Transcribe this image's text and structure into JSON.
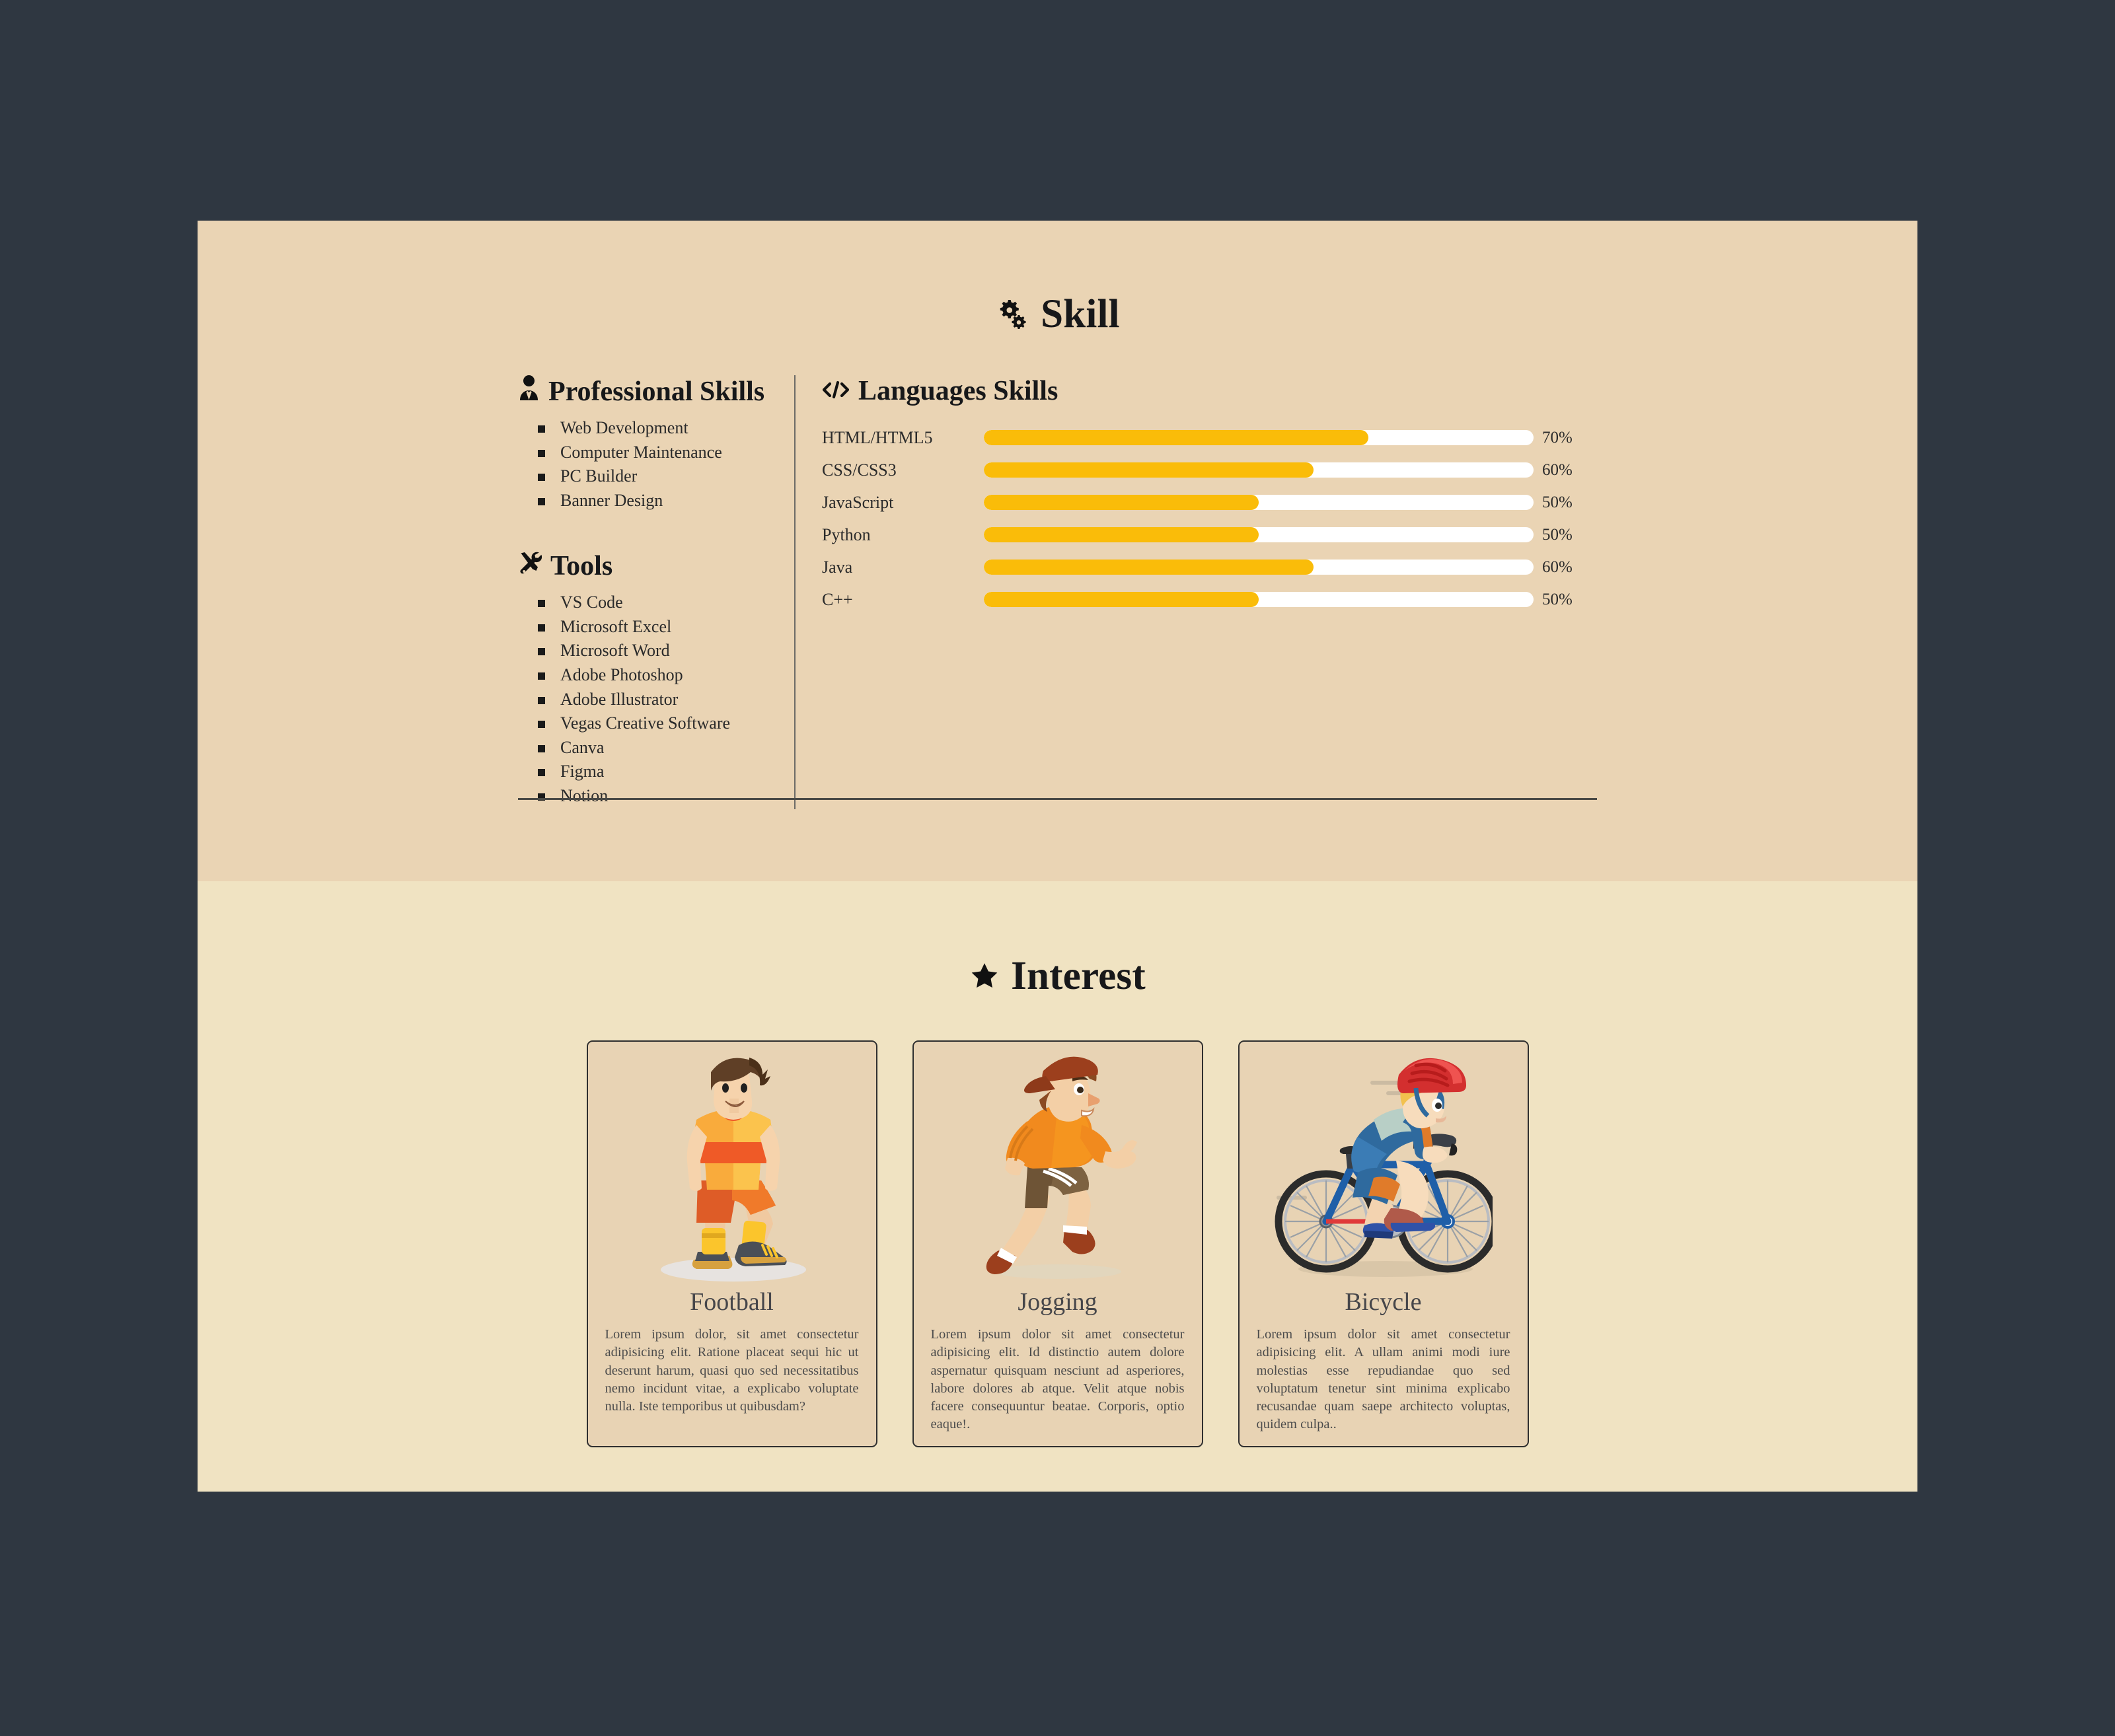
{
  "skill": {
    "title": "Skill",
    "title_icon": "gears-icon",
    "professional": {
      "heading": "Professional Skills",
      "icon": "person-tie-icon",
      "items": [
        "Web Development",
        "Computer Maintenance",
        "PC Builder",
        "Banner Design"
      ]
    },
    "tools": {
      "heading": "Tools",
      "icon": "wrench-screwdriver-icon",
      "items": [
        "VS Code",
        "Microsoft Excel",
        "Microsoft Word",
        "Adobe Photoshop",
        "Adobe Illustrator",
        "Vegas Creative Software",
        "Canva",
        "Figma",
        "Notion"
      ]
    },
    "languages": {
      "heading": "Languages Skills",
      "icon": "code-tag-icon",
      "bar_fill_color": "#FABC09",
      "bar_track_color": "#FFFFFF",
      "items": [
        {
          "name": "HTML/HTML5",
          "percent": 70,
          "label": "70%"
        },
        {
          "name": "CSS/CSS3",
          "percent": 60,
          "label": "60%"
        },
        {
          "name": "JavaScript",
          "percent": 50,
          "label": "50%"
        },
        {
          "name": "Python",
          "percent": 50,
          "label": "50%"
        },
        {
          "name": "Java",
          "percent": 60,
          "label": "60%"
        },
        {
          "name": "C++",
          "percent": 50,
          "label": "50%"
        }
      ]
    }
  },
  "interest": {
    "title": "Interest",
    "title_icon": "star-icon",
    "cards": [
      {
        "title": "Football",
        "art": "football-player-illustration",
        "text": "Lorem ipsum dolor, sit amet consectetur adipisicing elit. Ratione placeat sequi hic ut deserunt harum, quasi quo sed necessitatibus nemo incidunt vitae, a explicabo voluptate nulla. Iste temporibus ut quibusdam?"
      },
      {
        "title": "Jogging",
        "art": "jogging-man-illustration",
        "text": "Lorem ipsum dolor sit amet consectetur adipisicing elit. Id distinctio autem dolore aspernatur quisquam nesciunt ad asperiores, labore dolores ab atque. Velit atque nobis facere consequuntur beatae. Corporis, optio eaque!."
      },
      {
        "title": "Bicycle",
        "art": "cyclist-illustration",
        "text": "Lorem ipsum dolor sit amet consectetur adipisicing elit. A ullam animi modi iure molestias esse repudiandae quo sed voluptatum tenetur sint minima explicabo recusandae quam saepe architecto voluptas, quidem culpa.."
      }
    ]
  },
  "theme": {
    "page_background": "#2F3741",
    "skill_background": "#EAD4B4",
    "interest_background": "#F0E3C2",
    "card_background": "#E8D3B4",
    "accent": "#FABC09"
  }
}
